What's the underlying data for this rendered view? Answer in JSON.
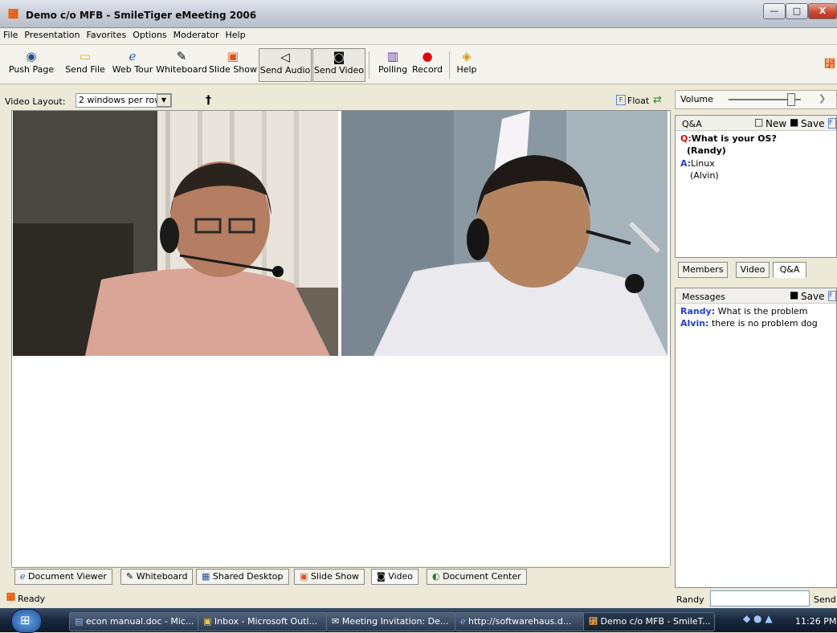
{
  "window": {
    "title": "Demo c/o MFB - SmileTiger eMeeting 2006",
    "min_glyph": "—",
    "max_glyph": "□",
    "close_glyph": "X"
  },
  "menu": [
    "File",
    "Presentation",
    "Favorites",
    "Options",
    "Moderator",
    "Help"
  ],
  "toolbar": [
    {
      "label": "Push Page",
      "icon": "globe-icon",
      "glyph": "◉",
      "color": "#1f4f8a"
    },
    {
      "label": "Send File",
      "icon": "folder-icon",
      "glyph": "▭",
      "color": "#e0b020"
    },
    {
      "label": "Web Tour",
      "icon": "ie-icon",
      "glyph": "ℯ",
      "color": "#1f65c8"
    },
    {
      "label": "Whiteboard",
      "icon": "whiteboard-icon",
      "glyph": "✎",
      "color": "#444444"
    },
    {
      "label": "Slide Show",
      "icon": "slideshow-icon",
      "glyph": "▣",
      "color": "#d8551f"
    },
    {
      "label": "Send Audio",
      "icon": "speaker-icon",
      "glyph": "◁",
      "color": "#333333"
    },
    {
      "label": "Send Video",
      "icon": "camera-icon",
      "glyph": "◙",
      "color": "#333333"
    },
    {
      "label": "Polling",
      "icon": "bar-chart-icon",
      "glyph": "▥",
      "color": "#6b2fa0"
    },
    {
      "label": "Record",
      "icon": "record-icon",
      "glyph": "●",
      "color": "#e00000"
    },
    {
      "label": "Help",
      "icon": "help-book-icon",
      "glyph": "◈",
      "color": "#d79b12"
    }
  ],
  "video_layout": {
    "label": "Video Layout:",
    "value": "2 windows per row",
    "float_label": "Float"
  },
  "bottom_tabs": [
    {
      "label": "Document Viewer",
      "icon": "ie-icon",
      "glyph": "ℯ",
      "active": false
    },
    {
      "label": "Whiteboard",
      "icon": "whiteboard-icon",
      "glyph": "✎",
      "active": false
    },
    {
      "label": "Shared Desktop",
      "icon": "shared-desktop-icon",
      "glyph": "▦",
      "active": false
    },
    {
      "label": "Slide Show",
      "icon": "slideshow-icon",
      "glyph": "▣",
      "active": false
    },
    {
      "label": "Video",
      "icon": "camera-icon",
      "glyph": "◙",
      "active": true
    },
    {
      "label": "Document Center",
      "icon": "document-center-icon",
      "glyph": "◐",
      "active": false
    }
  ],
  "status": {
    "text": "Ready"
  },
  "right": {
    "volume_label": "Volume",
    "volume_level": 0.85,
    "qa": {
      "header": "Q&A",
      "new_label": "New",
      "save_label": "Save",
      "q_prefix": "Q:",
      "question": "What is your OS?",
      "asker": "(Randy)",
      "a_prefix": "A:",
      "answer": "Linux",
      "answerer": "(Alvin)"
    },
    "tabs": [
      {
        "label": "Members",
        "active": false
      },
      {
        "label": "Video",
        "active": false
      },
      {
        "label": "Q&A",
        "active": true
      }
    ],
    "messages": {
      "header": "Messages",
      "save_label": "Save",
      "items": [
        {
          "sender": "Randy:",
          "text": "What is the problem"
        },
        {
          "sender": "Alvin:",
          "text": "there is no problem dog"
        }
      ]
    },
    "chat": {
      "user": "Randy",
      "send_label": "Send",
      "input_value": ""
    }
  },
  "taskbar": {
    "items": [
      {
        "label": "econ manual.doc - Mic...",
        "icon": "word-icon",
        "active": false
      },
      {
        "label": "Inbox - Microsoft Outl...",
        "icon": "outlook-icon",
        "active": false
      },
      {
        "label": "Meeting Invitation: De...",
        "icon": "mail-icon",
        "active": false
      },
      {
        "label": "http://softwarehaus.d...",
        "icon": "ie-icon",
        "active": false
      },
      {
        "label": "Demo c/o MFB - SmileT...",
        "icon": "smiletiger-icon",
        "active": true
      }
    ],
    "clock": "11:26 PM"
  },
  "colors": {
    "question": "#d01010",
    "answer_prefix": "#1f3fd0",
    "sender": "#1f3fd0"
  }
}
